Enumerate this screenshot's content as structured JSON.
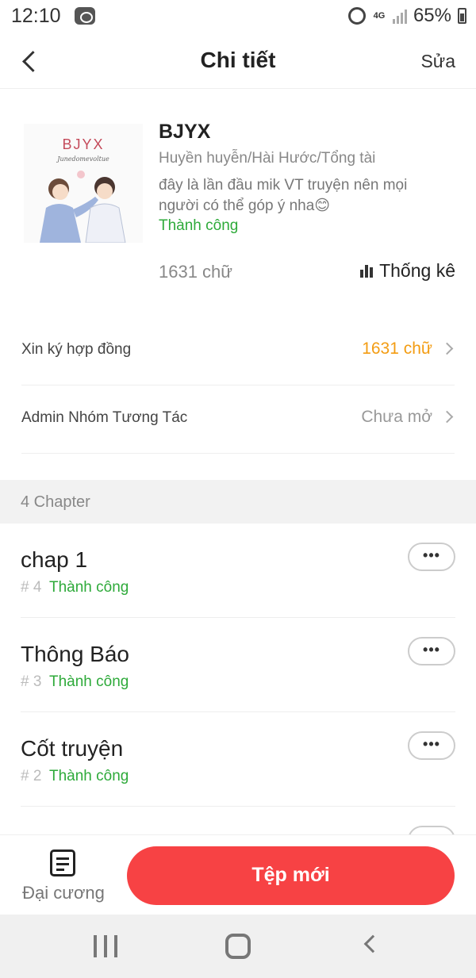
{
  "status_bar": {
    "time": "12:10",
    "network": "4G",
    "battery": "65%"
  },
  "app_bar": {
    "title": "Chi tiết",
    "edit_label": "Sửa"
  },
  "book": {
    "cover_title": "BJYX",
    "cover_subtitle": "Junedomevoltue",
    "title": "BJYX",
    "genre": "Huyền huyễn/Hài Hước/Tổng tài",
    "description": "đây là lần đầu mik VT truyện nên mọi người có thể góp ý nha😊",
    "status": "Thành công",
    "word_count": "1631 chữ",
    "stats_label": "Thống kê"
  },
  "rows": [
    {
      "label": "Xin ký hợp đồng",
      "value": "1631 chữ",
      "value_color": "#f39c12"
    },
    {
      "label": "Admin Nhóm Tương Tác",
      "value": "Chưa mở",
      "value_color": "#999999"
    }
  ],
  "chapters_header": "4 Chapter",
  "chapters": [
    {
      "title": "chap 1",
      "number": "# 4",
      "status": "Thành công"
    },
    {
      "title": "Thông Báo",
      "number": "# 3",
      "status": "Thành công"
    },
    {
      "title": "Cốt truyện",
      "number": "# 2",
      "status": "Thành công"
    }
  ],
  "bottom_bar": {
    "outline_label": "Đại cương",
    "new_button_label": "Tệp mới"
  },
  "colors": {
    "accent": "#f74244",
    "success": "#2eaa3a",
    "highlight": "#f39c12"
  }
}
